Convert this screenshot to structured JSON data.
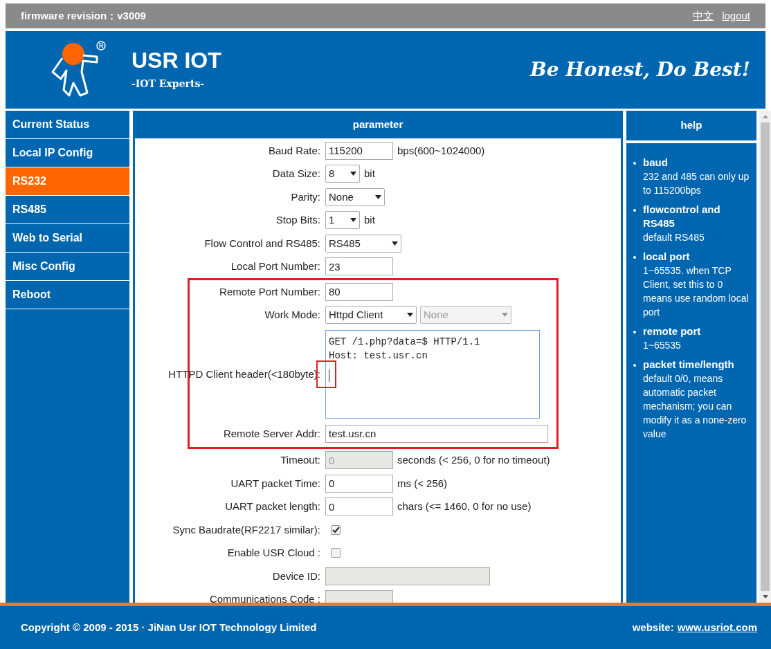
{
  "top_bar": {
    "firmware": "firmware revision：v3009",
    "links": [
      "中文",
      "logout"
    ]
  },
  "header": {
    "brand": "USR IOT",
    "tagline": "-IOT Experts-",
    "slogan": "Be Honest, Do Best!"
  },
  "sidebar": {
    "items": [
      {
        "label": "Current Status",
        "selected": false
      },
      {
        "label": "Local IP Config",
        "selected": false
      },
      {
        "label": "RS232",
        "selected": true
      },
      {
        "label": "RS485",
        "selected": false
      },
      {
        "label": "Web to Serial",
        "selected": false
      },
      {
        "label": "Misc Config",
        "selected": false
      },
      {
        "label": "Reboot",
        "selected": false
      }
    ]
  },
  "parameter": {
    "title": "parameter",
    "rows": [
      {
        "kind": "text",
        "label": "Baud Rate:",
        "value": "115200",
        "unit": "bps(600~1024000)",
        "highlighted": false
      },
      {
        "kind": "select-short",
        "label": "Data Size:",
        "value": "8",
        "unit": "bit",
        "highlighted": false
      },
      {
        "kind": "select-mid",
        "label": "Parity:",
        "value": "None",
        "highlighted": false
      },
      {
        "kind": "select-short",
        "label": "Stop Bits:",
        "value": "1",
        "unit": "bit",
        "highlighted": false
      },
      {
        "kind": "select",
        "label": "Flow Control and RS485:",
        "value": "RS485",
        "highlighted": false
      },
      {
        "kind": "text",
        "label": "Local Port Number:",
        "value": "23",
        "highlighted": false
      },
      {
        "kind": "text",
        "label": "Remote Port Number:",
        "value": "80",
        "highlighted": true
      },
      {
        "kind": "select-pair",
        "label": "Work Mode:",
        "value": "Httpd Client",
        "second": {
          "value": "None",
          "disabled": true
        },
        "highlighted": true
      },
      {
        "kind": "textarea",
        "label": "HTTPD Client header(<180byte):",
        "lines": [
          "GET /1.php?data=$ HTTP/1.1",
          "Host: test.usr.cn"
        ],
        "highlighted": true
      },
      {
        "kind": "text-wide",
        "label": "Remote Server Addr:",
        "value": "test.usr.cn",
        "highlighted": true
      },
      {
        "kind": "text",
        "label": "Timeout:",
        "value": "0",
        "disabled": true,
        "unit": "seconds (< 256, 0 for no timeout)",
        "highlighted": false
      },
      {
        "kind": "text",
        "label": "UART packet Time:",
        "value": "0",
        "unit": "ms (< 256)",
        "highlighted": false
      },
      {
        "kind": "text",
        "label": "UART packet length:",
        "value": "0",
        "unit": "chars (<= 1460, 0 for no use)",
        "highlighted": false
      },
      {
        "kind": "checkbox",
        "label": "Sync Baudrate(RF2217 similar):",
        "checked": true,
        "highlighted": false
      },
      {
        "kind": "checkbox",
        "label": "Enable USR Cloud :",
        "checked": false,
        "highlighted": false
      },
      {
        "kind": "text-mid",
        "label": "Device ID:",
        "disabled": true,
        "highlighted": false
      },
      {
        "kind": "text",
        "label": "Communications Code :",
        "disabled": true,
        "highlighted": false
      }
    ]
  },
  "help": {
    "title": "help",
    "items": [
      {
        "term": "baud",
        "text": "232 and 485 can only up to 115200bps"
      },
      {
        "term": "flowcontrol and RS485",
        "text": "default RS485"
      },
      {
        "term": "local port",
        "text": "1~65535. when TCP Client, set this to 0 means use random local port"
      },
      {
        "term": "remote port",
        "text": "1~65535"
      },
      {
        "term": "packet time/length",
        "text": "default 0/0, means automatic packet mechanism; you can modify it as a none-zero value"
      }
    ]
  },
  "footer": {
    "copyright": "Copyright © 2009 - 2015 · JiNan Usr IOT Technology Limited",
    "website_label": "website:",
    "website": "www.usriot.com"
  }
}
